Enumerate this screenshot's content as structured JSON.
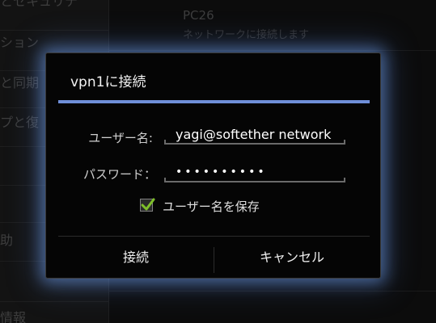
{
  "background": {
    "left_items": [
      "とセキュリテ",
      "ション",
      "と同期",
      "プと復",
      "",
      "助",
      "",
      "情報"
    ],
    "right_title": "PC26",
    "right_subtitle": "ネットワークに接続します"
  },
  "dialog": {
    "title": "vpn1に接続",
    "username_label": "ユーザー名:",
    "username_value": "yagi@softether network",
    "password_label": "パスワード：",
    "password_value": "••••••••••",
    "save_username_label": "ユーザー名を保存",
    "save_username_checked": true,
    "connect_button": "接続",
    "cancel_button": "キャンセル"
  },
  "colors": {
    "accent": "#6f8fd9",
    "check": "#7fbf2a",
    "glow": "#78aaff"
  },
  "icons": {
    "checkmark": "checkmark-icon"
  }
}
